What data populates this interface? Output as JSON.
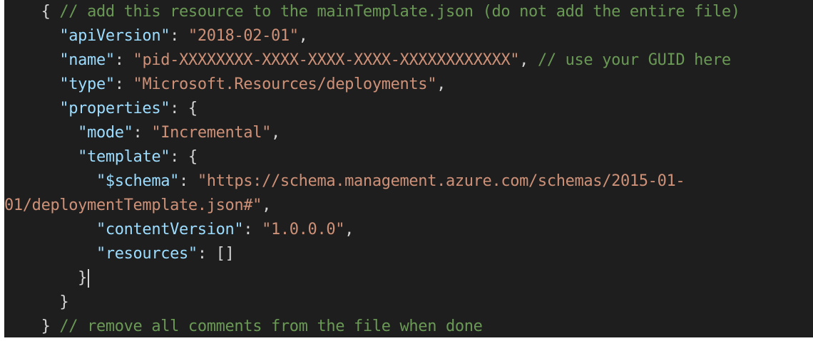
{
  "colors": {
    "background": "#1e1e1e",
    "key": "#9cdcfe",
    "string": "#ce9178",
    "comment": "#6a9955",
    "punctuation": "#d4d4d4"
  },
  "code": {
    "l1": {
      "indent": "    ",
      "brace": "{ ",
      "comment": "// add this resource to the mainTemplate.json (do not add the entire file)"
    },
    "l2": {
      "indent": "      ",
      "key": "\"apiVersion\"",
      "sep": ": ",
      "value": "\"2018-02-01\"",
      "tail": ","
    },
    "l3": {
      "indent": "      ",
      "key": "\"name\"",
      "sep": ": ",
      "value": "\"pid-XXXXXXXX-XXXX-XXXX-XXXX-XXXXXXXXXXXX\"",
      "tail": ", ",
      "comment": "// use your GUID here"
    },
    "l4": {
      "indent": "      ",
      "key": "\"type\"",
      "sep": ": ",
      "value": "\"Microsoft.Resources/deployments\"",
      "tail": ","
    },
    "l5": {
      "indent": "      ",
      "key": "\"properties\"",
      "sep": ": {"
    },
    "l6": {
      "indent": "        ",
      "key": "\"mode\"",
      "sep": ": ",
      "value": "\"Incremental\"",
      "tail": ","
    },
    "l7": {
      "indent": "        ",
      "key": "\"template\"",
      "sep": ": {"
    },
    "l8": {
      "indent": "          ",
      "key": "\"$schema\"",
      "sep": ": ",
      "value": "\"https://schema.management.azure.com/schemas/2015-01-"
    },
    "l9": {
      "value": "01/deploymentTemplate.json#\"",
      "tail": ","
    },
    "l10": {
      "indent": "          ",
      "key": "\"contentVersion\"",
      "sep": ": ",
      "value": "\"1.0.0.0\"",
      "tail": ","
    },
    "l11": {
      "indent": "          ",
      "key": "\"resources\"",
      "sep": ": []"
    },
    "l12": {
      "indent": "        ",
      "brace": "}"
    },
    "l13": {
      "indent": "      ",
      "brace": "}"
    },
    "l14": {
      "indent": "    ",
      "brace": "} ",
      "comment": "// remove all comments from the file when done"
    }
  }
}
